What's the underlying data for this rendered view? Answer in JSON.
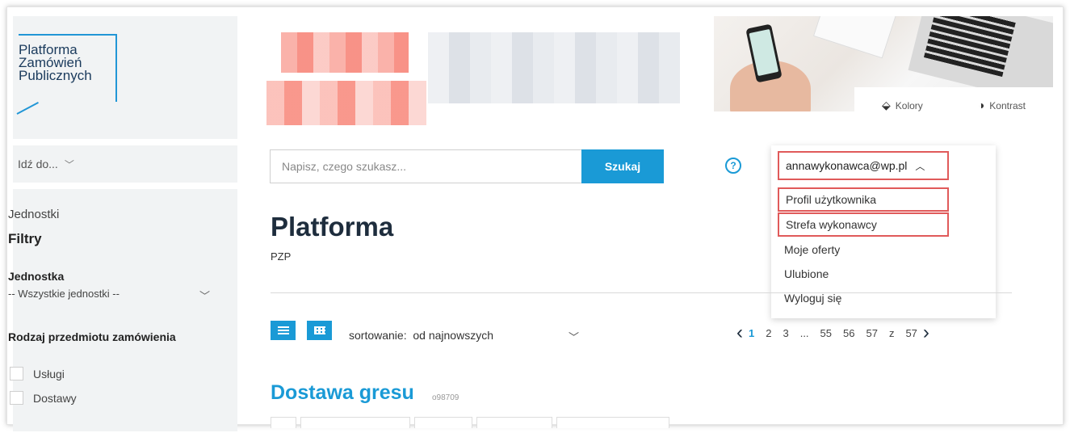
{
  "logo": {
    "lines": [
      "Platforma",
      "Zamówień",
      "Publicznych"
    ]
  },
  "sidebar": {
    "goto_label": "Idź do...",
    "units_link": "Jednostki",
    "filters_title": "Filtry",
    "unit_label": "Jednostka",
    "unit_value": "-- Wszystkie jednostki --",
    "category_label": "Rodzaj przedmiotu zamówienia",
    "categories": [
      "Usługi",
      "Dostawy"
    ]
  },
  "accessibility": {
    "colors_label": "Kolory",
    "contrast_label": "Kontrast"
  },
  "search": {
    "placeholder": "Napisz, czego szukasz...",
    "button_label": "Szukaj"
  },
  "help_icon": "?",
  "user_menu": {
    "email": "annawykonawca@wp.pl",
    "items": [
      "Profil użytkownika",
      "Strefa wykonawcy",
      "Moje oferty",
      "Ulubione",
      "Wyloguj się"
    ]
  },
  "page": {
    "title": "Platforma",
    "subtitle": "PZP"
  },
  "sort": {
    "label": "sortowanie:",
    "value": "od najnowszych"
  },
  "pagination": {
    "pages": [
      "1",
      "2",
      "3",
      "...",
      "55",
      "56",
      "57"
    ],
    "of_label": "z",
    "total": "57",
    "current": "1"
  },
  "listing": {
    "title": "Dostawa gresu",
    "code": "o98709"
  },
  "colors": {
    "accent": "#1a9ad6",
    "highlight": "#e05a5a",
    "heading": "#1e2d3d"
  },
  "icons": [
    "chevron-down-icon",
    "palette-icon",
    "contrast-icon",
    "help-icon",
    "chevron-up-icon",
    "list-view-icon",
    "grid-view-icon",
    "chevron-left-icon",
    "chevron-right-icon"
  ]
}
